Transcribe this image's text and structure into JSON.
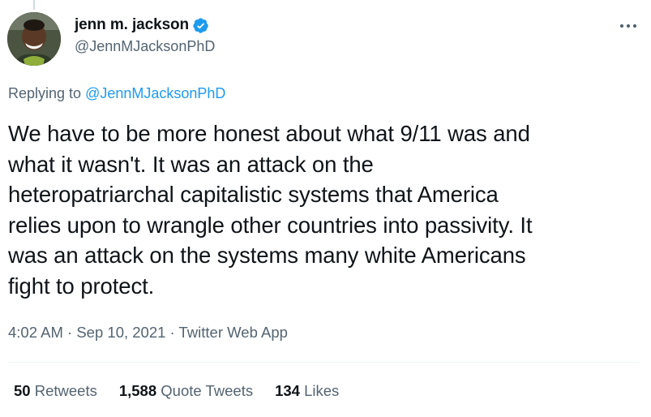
{
  "author": {
    "display_name": "jenn m. jackson",
    "handle": "@JennMJacksonPhD",
    "verified": true,
    "verified_color": "#1d9bf0"
  },
  "menu": {
    "more_icon": "more-horizontal-icon"
  },
  "reply": {
    "prefix": "Replying to ",
    "to_handle": "@JennMJacksonPhD"
  },
  "tweet": {
    "text": "We have to be more honest about what 9/11 was and\nwhat it wasn't. It was an attack on the\nheteropatriarchal capitalistic systems that America\nrelies upon to wrangle other countries into passivity. It\nwas an attack on the systems many white Americans\nfight to protect."
  },
  "meta": {
    "time": "4:02 AM",
    "sep1": " · ",
    "date": "Sep 10, 2021",
    "sep2": " · ",
    "source": "Twitter Web App"
  },
  "stats": {
    "retweets_count": "50",
    "retweets_label": " Retweets",
    "quotes_count": "1,588",
    "quotes_label": " Quote Tweets",
    "likes_count": "134",
    "likes_label": " Likes"
  },
  "colors": {
    "text_primary": "#0f1419",
    "text_secondary": "#536471",
    "link": "#1d9bf0",
    "divider": "#eff3f4"
  }
}
